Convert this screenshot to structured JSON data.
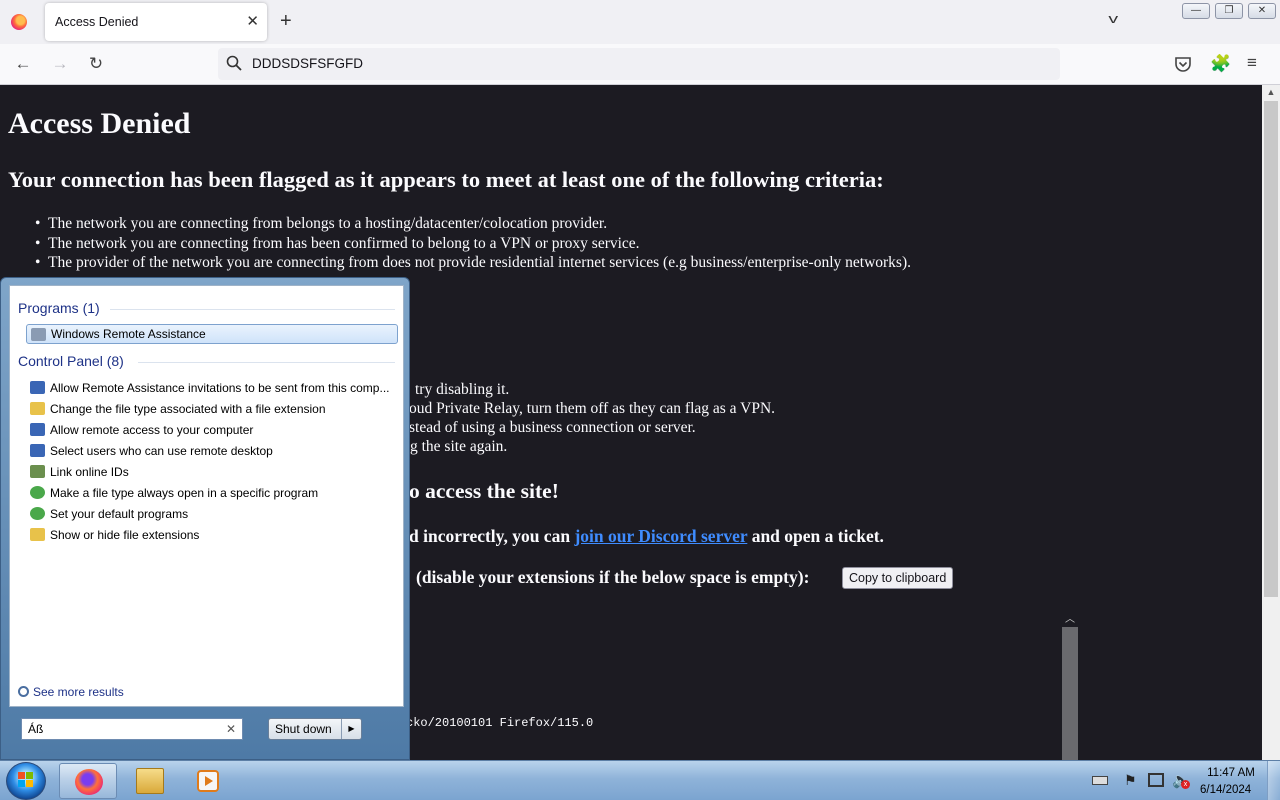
{
  "browser": {
    "tab_title": "Access Denied",
    "tab_close": "✕",
    "new_tab": "+",
    "tab_list": "v",
    "window_min": "—",
    "window_max": "❐",
    "window_close": "✕",
    "back": "←",
    "forward": "→",
    "reload": "↻",
    "url": "DDDSDSFSFGFD",
    "extensions": "🧩",
    "menu": "≡"
  },
  "page": {
    "title": "Access Denied",
    "subtitle": "Your connection has been flagged as it appears to meet at least one of the following criteria:",
    "criteria": [
      "The network you are connecting from belongs to a hosting/datacenter/colocation provider.",
      "The network you are connecting from has been confirmed to belong to a VPN or proxy service.",
      "The provider of the network you are connecting from does not provide residential internet services (e.g business/enterprise-only networks)."
    ],
    "partial_lines": [
      "try disabling it.",
      "oud Private Relay, turn them off as they can flag as a VPN.",
      "stead of using a business connection or server.",
      "g the site again."
    ],
    "partial_heading": "o access the site!",
    "discord_prefix": "d incorrectly, you can",
    "discord_link": "join our Discord server",
    "discord_suffix": "and open a ticket.",
    "ua_prompt": "(disable your extensions if the below space is empty):",
    "copy_button": "Copy to clipboard",
    "user_agent_fragment": "cko/20100101 Firefox/115.0"
  },
  "start_menu": {
    "programs_header": "Programs (1)",
    "programs": [
      {
        "label": "Windows Remote Assistance",
        "icon": "remote-assistance-icon",
        "color": "#8a9bb3"
      }
    ],
    "control_panel_header": "Control Panel (8)",
    "control_panel": [
      {
        "label": "Allow Remote Assistance invitations to be sent from this comp...",
        "icon": "system-icon",
        "color": "#3a66b5"
      },
      {
        "label": "Change the file type associated with a file extension",
        "icon": "folder-options-icon",
        "color": "#e8c24a"
      },
      {
        "label": "Allow remote access to your computer",
        "icon": "system-icon",
        "color": "#3a66b5"
      },
      {
        "label": "Select users who can use remote desktop",
        "icon": "system-icon",
        "color": "#3a66b5"
      },
      {
        "label": "Link online IDs",
        "icon": "user-accounts-icon",
        "color": "#6b8f4e"
      },
      {
        "label": "Make a file type always open in a specific program",
        "icon": "default-programs-icon",
        "color": "#4aa84a"
      },
      {
        "label": "Set your default programs",
        "icon": "default-programs-icon",
        "color": "#4aa84a"
      },
      {
        "label": "Show or hide file extensions",
        "icon": "folder-options-icon",
        "color": "#e8c24a"
      }
    ],
    "see_more": "See more results",
    "search_value": "Áß",
    "search_clear": "✕",
    "shutdown_label": "Shut down",
    "shutdown_arrow": "▶"
  },
  "taskbar": {
    "clock_time": "11:47 AM",
    "clock_date": "6/14/2024",
    "tray_flag": "⚑",
    "tray_volume": "🔈",
    "tray_volume_muted": "x"
  },
  "colors": {
    "page_background": "#1c1b22",
    "link": "#3f8cff",
    "start_menu_header": "#1e3287"
  }
}
